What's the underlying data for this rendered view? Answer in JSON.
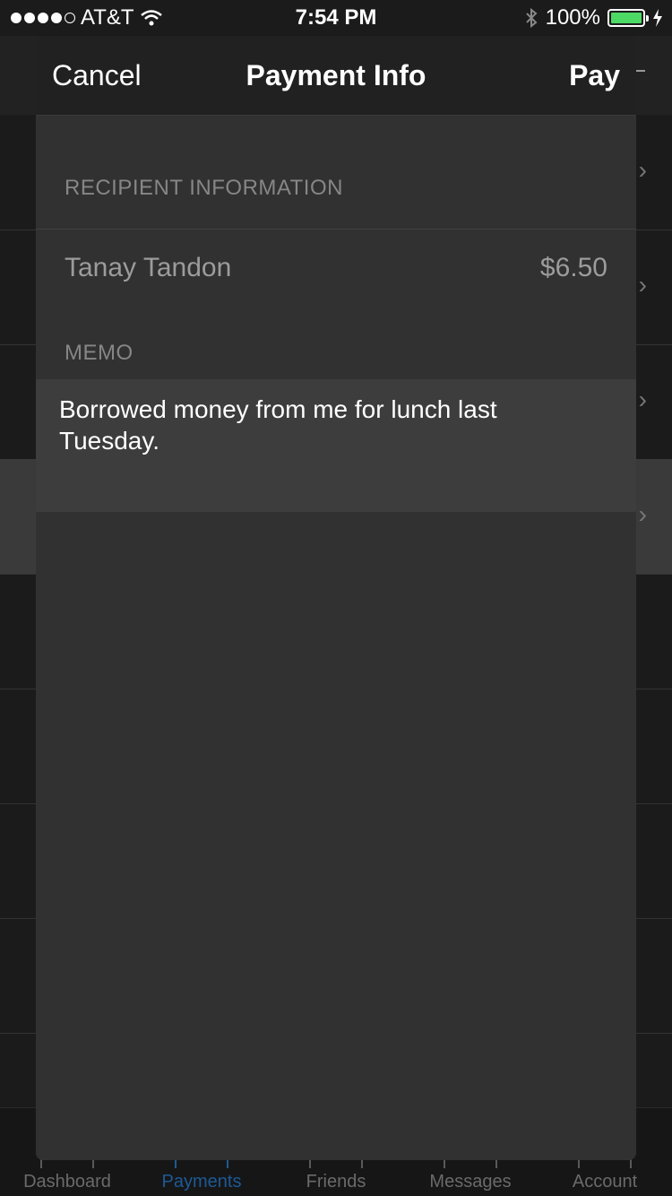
{
  "status_bar": {
    "carrier": "AT&T",
    "time": "7:54 PM",
    "battery": "100%"
  },
  "modal": {
    "cancel_label": "Cancel",
    "title": "Payment Info",
    "pay_label": "Pay",
    "recipient_header": "RECIPIENT INFORMATION",
    "recipient_name": "Tanay Tandon",
    "amount": "$6.50",
    "memo_header": "MEMO",
    "memo_text": "Borrowed money from me for lunch last Tuesday."
  },
  "tabbar": {
    "tabs": [
      {
        "label": "Dashboard"
      },
      {
        "label": "Payments"
      },
      {
        "label": "Friends"
      },
      {
        "label": "Messages"
      },
      {
        "label": "Account"
      }
    ]
  }
}
